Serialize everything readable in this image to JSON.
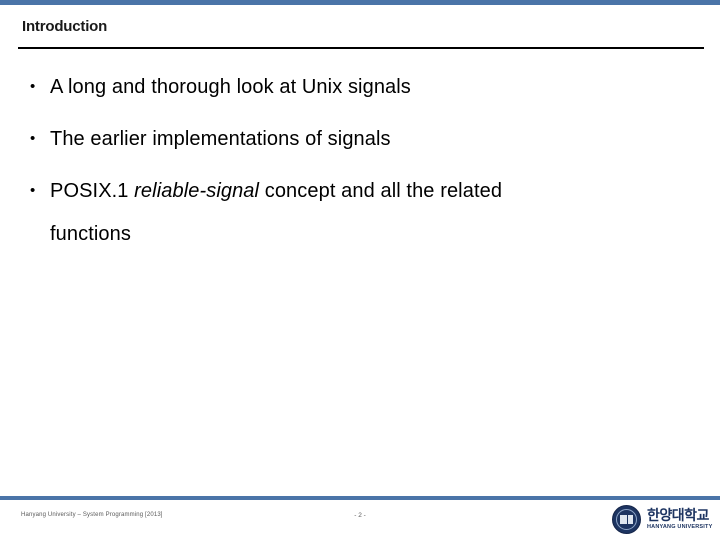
{
  "slide": {
    "title": "Introduction",
    "page_marker": "- 2 -",
    "accent_color": "#4a74a8",
    "rule_color": "#000000",
    "logo_color": "#1d3461"
  },
  "bullets": [
    {
      "marker": "•",
      "text": "A long and thorough look at Unix signals"
    },
    {
      "marker": "•",
      "text": "The earlier implementations of signals"
    },
    {
      "marker": "•",
      "text_before": "POSIX.1 ",
      "text_italic": "reliable-signal",
      "text_after": " concept and all the related",
      "continuation": "functions"
    }
  ],
  "footer": {
    "left_text": "Hanyang University – System Programming  [2013]"
  },
  "logo": {
    "korean": "한양대학교",
    "english": "HANYANG UNIVERSITY",
    "seal_name": "hanyang-seal-icon"
  }
}
